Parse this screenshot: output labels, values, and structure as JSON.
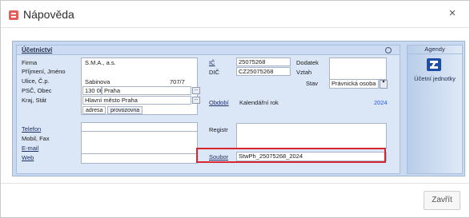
{
  "window": {
    "title": "Nápověda"
  },
  "panel": {
    "title": "Účetnictví"
  },
  "left": {
    "labels": {
      "firma": "Firma",
      "prijmeni": "Příjmení, Jméno",
      "ulice": "Ulice, Č.p.",
      "psc": "PSČ, Obec",
      "kraj": "Kraj, Stát",
      "telefon": "Telefon",
      "mobil": "Mobil, Fax",
      "email": "E-mail",
      "web": "Web"
    },
    "values": {
      "firma": "S.M.A., a.s.",
      "ulice": "Sabinova",
      "cislo": "707/7",
      "psc": "130 00",
      "obec": "Praha",
      "kraj": "Hlavní město Praha"
    },
    "tabs": [
      "adresa",
      "provozovna"
    ],
    "buttons": {
      "ellipsis": "..."
    }
  },
  "right": {
    "labels": {
      "ic": "IČ",
      "dic": "DIČ",
      "dodatek": "Dodatek",
      "vztah": "Vztah",
      "stav": "Stav",
      "obdobi": "Období",
      "registr": "Registr",
      "soubor": "Soubor"
    },
    "values": {
      "ic": "25075268",
      "dic": "CZ25075268",
      "stav": "Právnická osoba",
      "obdobi": "Kalendářní rok",
      "rok": "2024",
      "soubor": "StwPh_25075268_2024"
    }
  },
  "agenda": {
    "header": "Agendy",
    "item": "Účetní jednotky",
    "icon": "accounting-unit-icon"
  },
  "footer": {
    "close_label": "Zavřít"
  },
  "colors": {
    "highlight": "#d9252f",
    "accent_blue": "#2a5bd7",
    "panel_bg": "#dbe6f7"
  }
}
